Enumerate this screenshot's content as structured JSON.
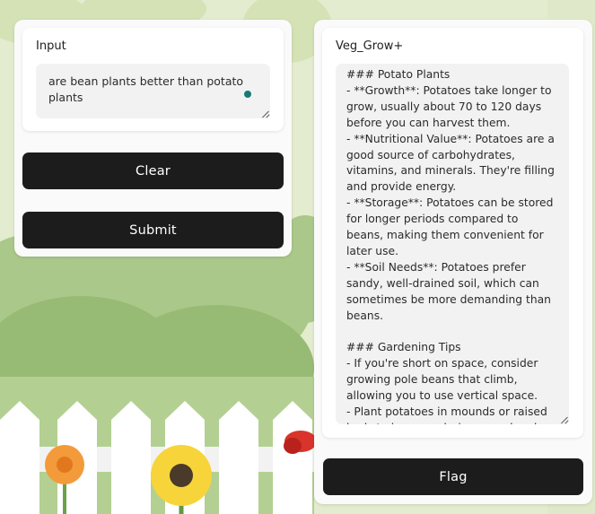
{
  "colors": {
    "accent": "#157b74",
    "button_bg": "#1c1c1c",
    "panel_bg": "#fafafa",
    "text_area_bg": "#f2f2f2"
  },
  "input": {
    "label": "Input",
    "value": "are bean plants better than potato plants"
  },
  "buttons": {
    "clear": "Clear",
    "submit": "Submit",
    "flag": "Flag"
  },
  "output": {
    "label": "Veg_Grow+",
    "text": "### Potato Plants\n- **Growth**: Potatoes take longer to grow, usually about 70 to 120 days before you can harvest them.\n- **Nutritional Value**: Potatoes are a good source of carbohydrates, vitamins, and minerals. They're filling and provide energy.\n- **Storage**: Potatoes can be stored for longer periods compared to beans, making them convenient for later use.\n- **Soil Needs**: Potatoes prefer sandy, well-drained soil, which can sometimes be more demanding than beans.\n\n### Gardening Tips\n- If you're short on space, consider growing pole beans that climb, allowing you to use vertical space.\n- Plant potatoes in mounds or raised beds to improve drainage and make harvesting easier."
  }
}
